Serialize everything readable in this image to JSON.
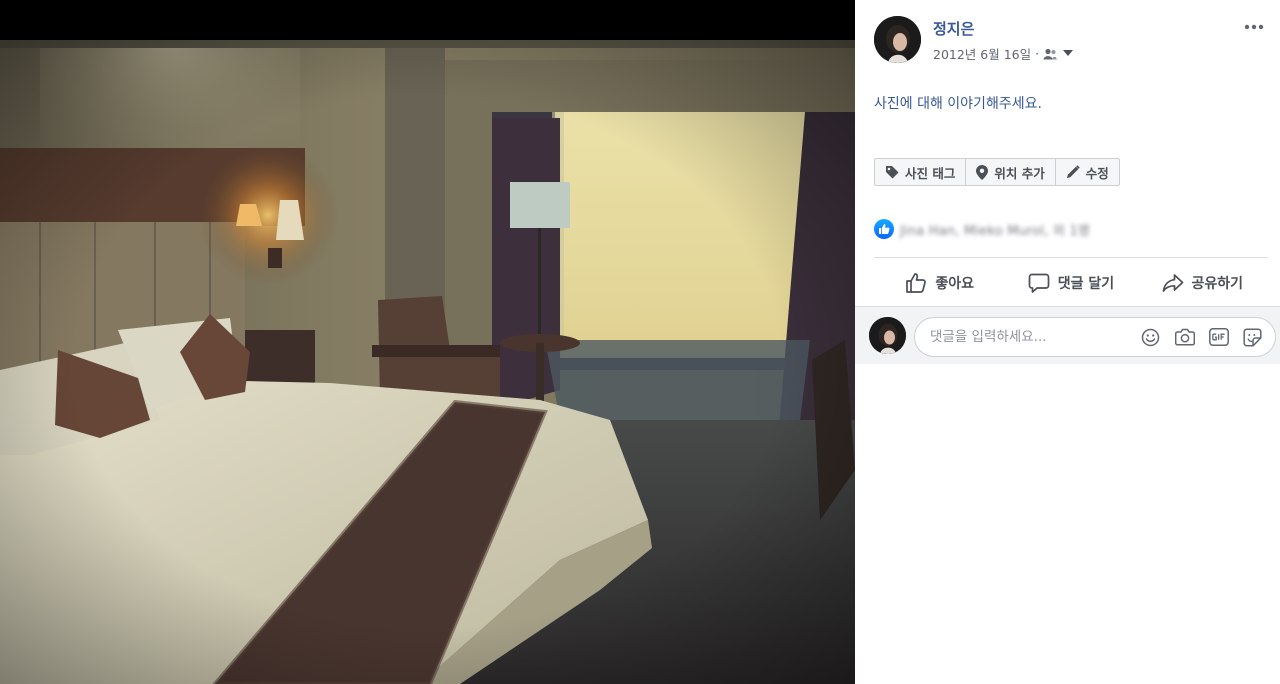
{
  "post": {
    "author_name": "정지은",
    "date": "2012년 6월 16일",
    "date_separator": "·",
    "caption_prompt": "사진에 대해 이야기해주세요.",
    "photo_actions": [
      {
        "label": "사진 태그",
        "icon": "tag-icon"
      },
      {
        "label": "위치 추가",
        "icon": "location-pin-icon"
      },
      {
        "label": "수정",
        "icon": "pencil-icon"
      }
    ],
    "reactions_text": "Jina Han, Mieko Murol, 외 1명",
    "actions": {
      "like": "좋아요",
      "comment": "댓글 달기",
      "share": "공유하기"
    },
    "comment": {
      "placeholder": "댓글을 입력하세요...",
      "icons": [
        "emoji-icon",
        "camera-icon",
        "gif-icon",
        "sticker-icon"
      ]
    }
  },
  "photo": {
    "description_colors": {
      "wall": "#8a7f63",
      "window": "#f5e6a0",
      "curtain": "#3f2f3a",
      "carpet": "#3d3a3c",
      "bedspread": "#ece5cc",
      "runner": "#4a342c"
    }
  },
  "colors": {
    "link": "#385898",
    "meta": "#616770",
    "like_blue": "#1877f2"
  }
}
